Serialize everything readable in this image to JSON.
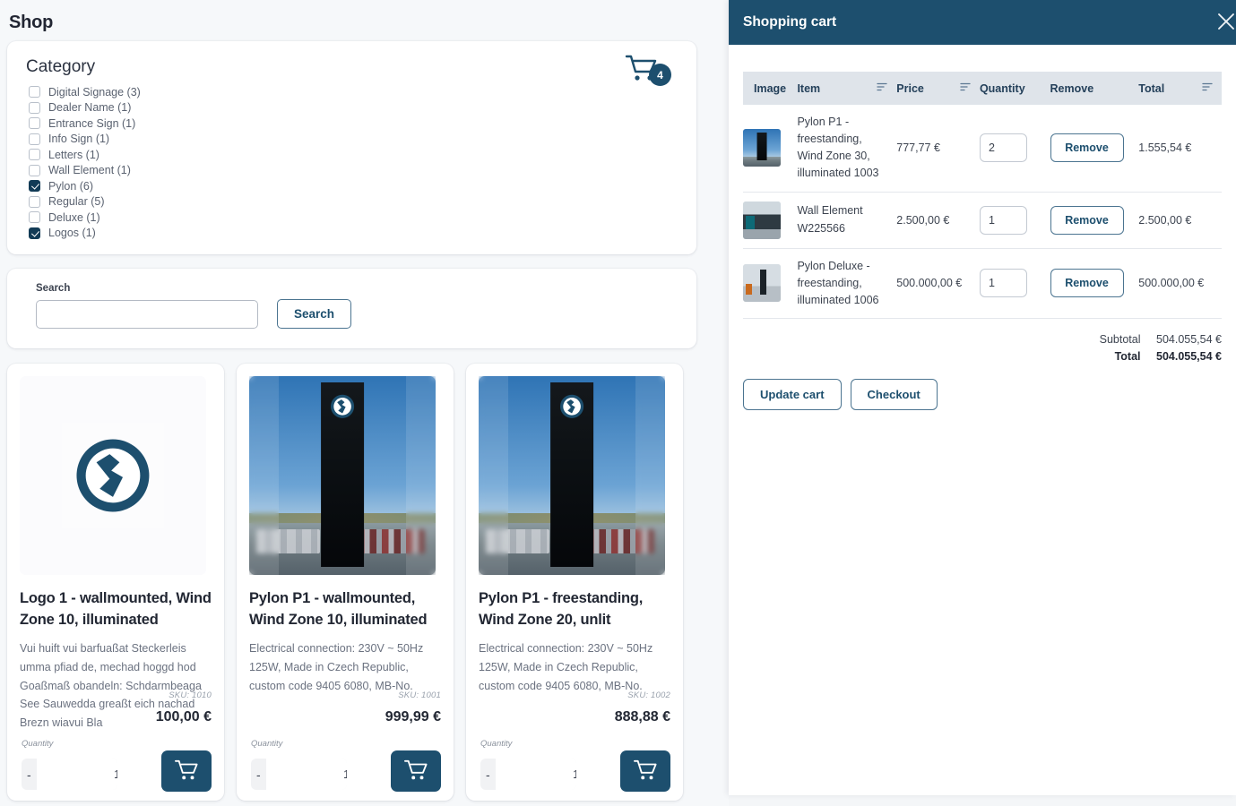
{
  "shop": {
    "title": "Shop",
    "category": {
      "heading": "Category",
      "items": [
        {
          "label": "Digital Signage (3)",
          "checked": false
        },
        {
          "label": "Dealer Name (1)",
          "checked": false
        },
        {
          "label": "Entrance Sign (1)",
          "checked": false
        },
        {
          "label": "Info Sign (1)",
          "checked": false
        },
        {
          "label": "Letters (1)",
          "checked": false
        },
        {
          "label": "Wall Element (1)",
          "checked": false
        },
        {
          "label": "Pylon (6)",
          "checked": true
        },
        {
          "label": "Regular (5)",
          "checked": false
        },
        {
          "label": "Deluxe (1)",
          "checked": false
        },
        {
          "label": "Logos (1)",
          "checked": true
        }
      ]
    },
    "cart_icon": {
      "name": "shopping-cart-icon",
      "badge_count": "4"
    },
    "search": {
      "label": "Search",
      "value": "",
      "placeholder": "",
      "button_label": "Search"
    },
    "products": [
      {
        "title": "Logo 1 - wallmounted, Wind Zone 10, illuminated",
        "description": "Vui huift vui barfuaßat Steckerleis umma pfiad de, mechad hoggd hod Goaßmaß obandeln: Schdarmbeaga See Sauwedda greaßt eich nachad Brezn wiavui Bla",
        "sku": "SKU: 1010",
        "price": "100,00 €",
        "quantity_label": "Quantity",
        "quantity": "1",
        "decrement_label": "-",
        "increment_label": "+",
        "image_kind": "logo",
        "add_to_cart_icon": "cart-plus-icon"
      },
      {
        "title": "Pylon P1 - wallmounted, Wind Zone 10, illuminated",
        "description": "Electrical connection: 230V ~ 50Hz 125W, Made in Czech Republic, custom code 9405 6080, MB-No.",
        "sku": "SKU: 1001",
        "price": "999,99 €",
        "quantity_label": "Quantity",
        "quantity": "1",
        "decrement_label": "-",
        "increment_label": "+",
        "image_kind": "pylon",
        "add_to_cart_icon": "cart-plus-icon"
      },
      {
        "title": "Pylon P1 - freestanding, Wind Zone 20, unlit",
        "description": "Electrical connection: 230V ~ 50Hz 125W, Made in Czech Republic, custom code 9405 6080, MB-No.",
        "sku": "SKU: 1002",
        "price": "888,88 €",
        "quantity_label": "Quantity",
        "quantity": "1",
        "decrement_label": "-",
        "increment_label": "+",
        "image_kind": "pylon",
        "add_to_cart_icon": "cart-plus-icon"
      }
    ]
  },
  "cart": {
    "title": "Shopping cart",
    "close_icon": "close-icon",
    "columns": [
      {
        "label": "Image",
        "sortable": false
      },
      {
        "label": "Item",
        "sortable": true
      },
      {
        "label": "Price",
        "sortable": true
      },
      {
        "label": "Quantity",
        "sortable": false
      },
      {
        "label": "Remove",
        "sortable": false
      },
      {
        "label": "Total",
        "sortable": true
      }
    ],
    "rows": [
      {
        "item": "Pylon P1 - freestanding, Wind Zone 30, illuminated 1003",
        "price": "777,77 €",
        "quantity": "2",
        "remove_label": "Remove",
        "total": "1.555,54 €",
        "thumb_kind": "pylon"
      },
      {
        "item": "Wall Element W225566",
        "price": "2.500,00 €",
        "quantity": "1",
        "remove_label": "Remove",
        "total": "2.500,00 €",
        "thumb_kind": "building"
      },
      {
        "item": "Pylon Deluxe - freestanding, illuminated 1006",
        "price": "500.000,00 €",
        "quantity": "1",
        "remove_label": "Remove",
        "total": "500.000,00 €",
        "thumb_kind": "deluxe"
      }
    ],
    "subtotal_label": "Subtotal",
    "subtotal_value": "504.055,54 €",
    "total_label": "Total",
    "total_value": "504.055,54 €",
    "update_label": "Update cart",
    "checkout_label": "Checkout"
  },
  "colors": {
    "accent": "#1d4f6e",
    "header_bg": "#1d4f6e",
    "table_header_bg": "#dfe4ea",
    "page_bg": "#f6f8fa"
  }
}
